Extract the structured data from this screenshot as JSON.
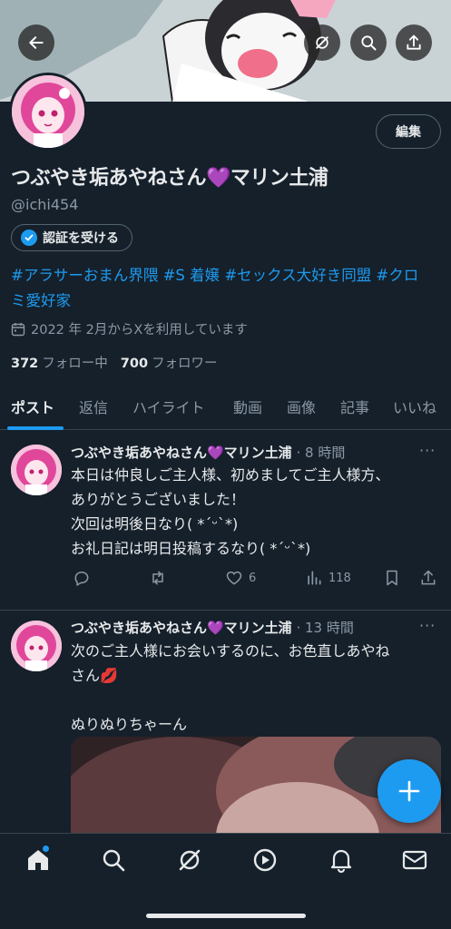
{
  "header": {
    "back_icon": "arrow-left-icon",
    "grok_icon": "grok-icon",
    "search_icon": "search-icon",
    "share_icon": "share-icon"
  },
  "profile": {
    "edit_label": "編集",
    "display_name": "つぶやき垢あやねさん💜マリン土浦",
    "handle": "@ichi454",
    "verify_label": "認証を受ける",
    "bio_line1": "#アラサーおまん界隈 #S 着嬢 #セックス大好き同盟 #クロ",
    "bio_line2": "ミ愛好家",
    "joined": "2022 年 2月からXを利用しています",
    "following_count": "372",
    "following_label": "フォロー中",
    "followers_count": "700",
    "followers_label": "フォロワー"
  },
  "tabs": [
    "ポスト",
    "返信",
    "ハイライト",
    "動画",
    "画像",
    "記事",
    "いいね"
  ],
  "tweets": [
    {
      "name": "つぶやき垢あやねさん💜マリン土浦",
      "time": "· 8 時間",
      "lines": [
        "本日は仲良しご主人様、初めましてご主人様方、",
        "ありがとうございました！",
        "次回は明後日なり( *ˊᵕˋ*)",
        "お礼日記は明日投稿するなり( *ˊᵕˋ*)"
      ],
      "likes": "6",
      "views": "118"
    },
    {
      "name": "つぶやき垢あやねさん💜マリン土浦",
      "time": "· 13 時間",
      "lines": [
        "次のご主人様にお会いするのに、お色直しあやね",
        "さん💋",
        "",
        "ぬりぬりちゃーん"
      ]
    }
  ],
  "more_glyph": "···",
  "colors": {
    "background": "#15202b",
    "accent": "#1d9bf0",
    "text": "#e7e9ea",
    "muted": "#8b98a5",
    "border": "#38444d"
  }
}
